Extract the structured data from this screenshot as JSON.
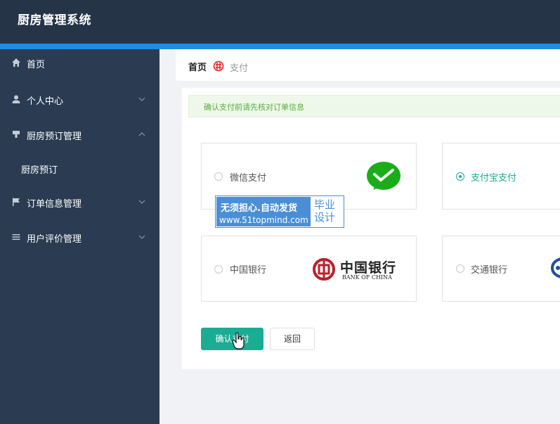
{
  "app": {
    "title": "厨房管理系统"
  },
  "sidebar": {
    "items": [
      {
        "label": "首页",
        "icon": "home-icon"
      },
      {
        "label": "个人中心",
        "icon": "user-icon"
      },
      {
        "label": "厨房预订管理",
        "icon": "stamp-icon"
      },
      {
        "label": "厨房预订",
        "icon": ""
      },
      {
        "label": "订单信息管理",
        "icon": "flag-icon"
      },
      {
        "label": "用户评价管理",
        "icon": "list-icon"
      }
    ]
  },
  "breadcrumb": {
    "home": "首页",
    "current": "支付"
  },
  "notice": "确认支付前请先核对订单信息",
  "payment": {
    "options": [
      {
        "label": "微信支付",
        "selected": false
      },
      {
        "label": "支付宝支付",
        "selected": true
      },
      {
        "label": "中国银行",
        "selected": false
      },
      {
        "label": "交通银行",
        "selected": false
      }
    ],
    "boc_logo_text": "中国银行",
    "boc_logo_en": "BANK OF CHINA"
  },
  "watermark": {
    "line1": "无须担心.自动发货",
    "line2": "www.51topmind.com",
    "right": "毕业设计"
  },
  "buttons": {
    "confirm": "确认支付",
    "back": "返回"
  },
  "colors": {
    "accent": "#1aad94",
    "header": "#263447",
    "sidebar": "#2b3c52",
    "bluebar": "#1a8fe3"
  }
}
